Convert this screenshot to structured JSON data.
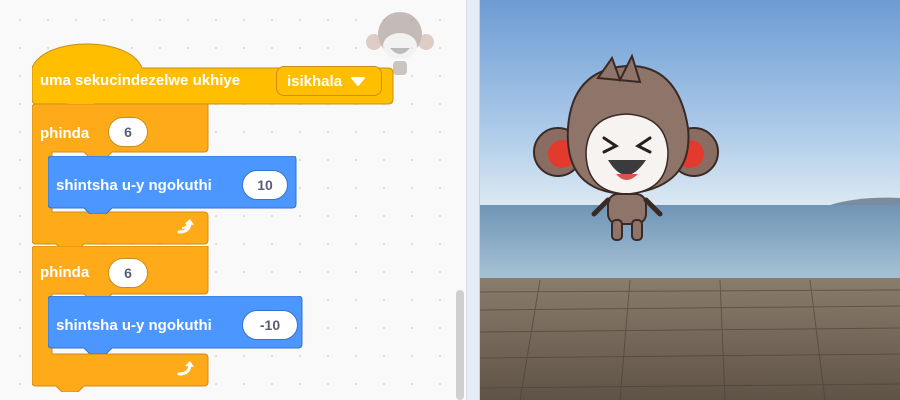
{
  "script": {
    "hat_block": {
      "label": "uma sekucindezelwe ukhiye",
      "key_option": "isikhala"
    },
    "repeat_blocks": [
      {
        "label": "phinda",
        "count": "6",
        "inner": {
          "label": "shintsha u-y ngokuthi",
          "value": "10"
        }
      },
      {
        "label": "phinda",
        "count": "6",
        "inner": {
          "label": "shintsha u-y ngokuthi",
          "value": "-10"
        }
      }
    ]
  },
  "colors": {
    "events": "#ffbf00",
    "control": "#ffab19",
    "motion": "#4c97ff",
    "workspace_bg": "#f9f9f9"
  },
  "icons": {
    "dropdown": "chevron-down-icon",
    "repeat": "loop-arrow-icon"
  },
  "stage": {
    "backdrop": "beach boardwalk",
    "sprite": "Chee monkey character"
  }
}
